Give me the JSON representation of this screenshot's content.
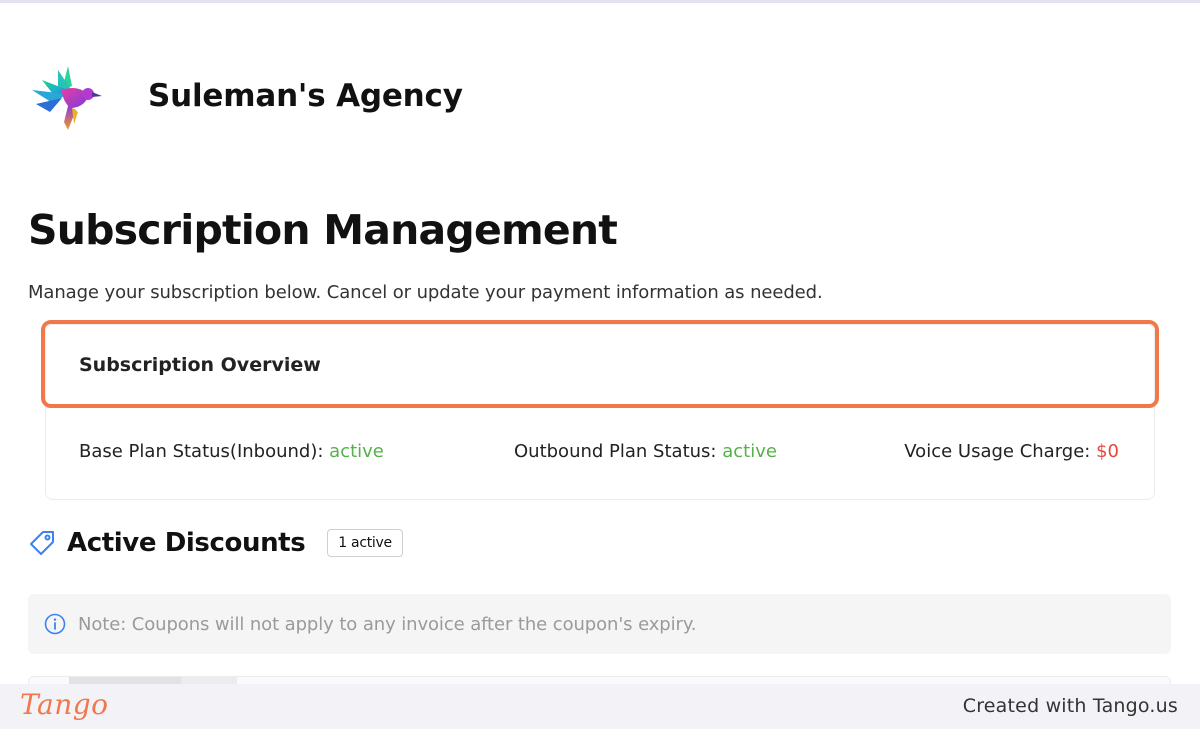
{
  "brand": {
    "name": "Suleman's Agency",
    "logo_icon": "hummingbird-logo-icon"
  },
  "page": {
    "title": "Subscription Management",
    "description": "Manage your subscription below. Cancel or update your payment information as needed."
  },
  "overview": {
    "title": "Subscription Overview",
    "base_plan_label": "Base Plan Status(Inbound):",
    "base_plan_value": "active",
    "outbound_plan_label": "Outbound Plan Status:",
    "outbound_plan_value": "active",
    "voice_usage_label": "Voice Usage Charge:",
    "voice_usage_value": "$0"
  },
  "discounts": {
    "title": "Active Discounts",
    "badge": "1 active",
    "icon": "tag-icon",
    "note": "Note: Coupons will not apply to any invoice after the coupon's expiry."
  },
  "footer": {
    "logo_text": "Tango",
    "created_with": "Created with Tango.us"
  },
  "colors": {
    "accent": "#f0784a",
    "active_green": "#56b14a",
    "charge_red": "#e5463f",
    "info_blue": "#3b82f6"
  }
}
